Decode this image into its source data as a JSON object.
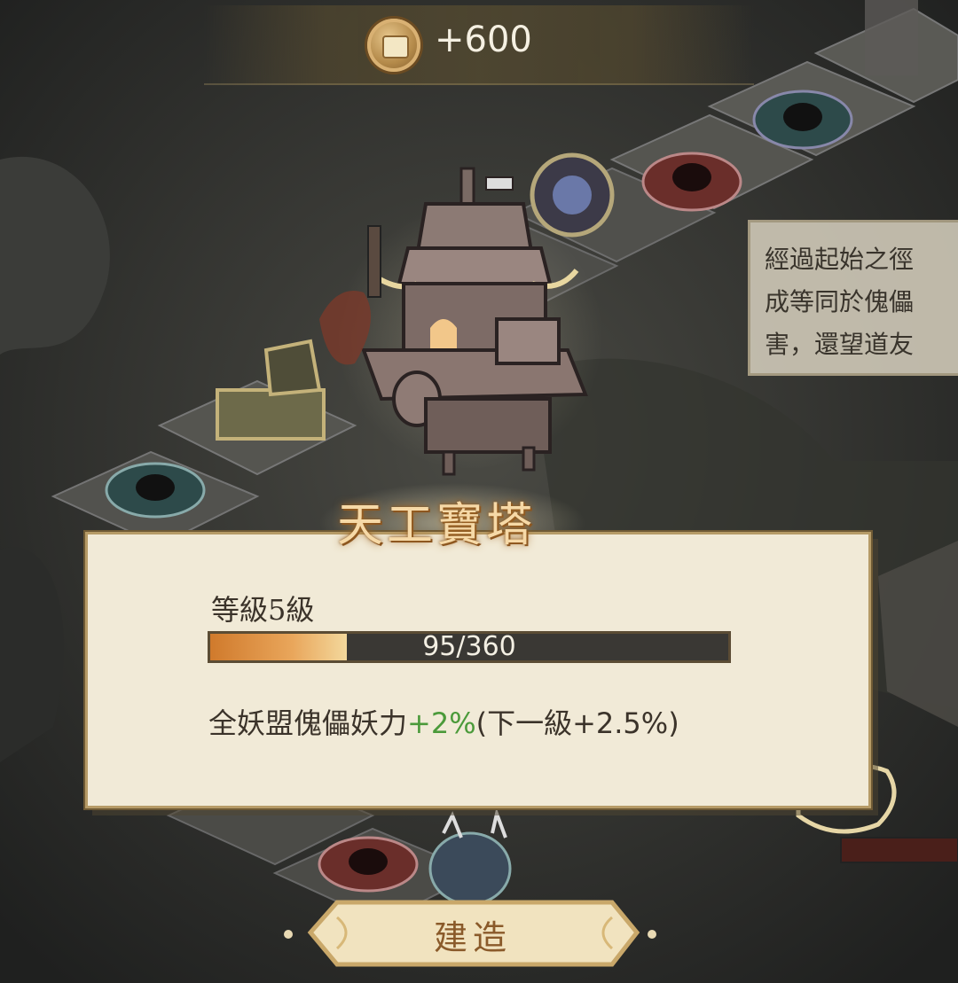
{
  "currency": {
    "icon": "coin-icon",
    "amount": "+600"
  },
  "hint": {
    "lines": [
      "經過起始之徑",
      "成等同於傀儡",
      "害，還望道友"
    ]
  },
  "building": {
    "name": "天工寶塔",
    "level_label": "等級5級",
    "progress": {
      "current": 95,
      "max": 360,
      "fraction": 0.264,
      "text": "95/360"
    },
    "effect_label": "全妖盟傀儡妖力",
    "effect_current": "+2%",
    "effect_next": "(下一級+2.5%)"
  },
  "actions": {
    "build_label": "建造"
  },
  "colors": {
    "accent_green": "#4b9a3a",
    "progress_orange": "#e9a65b",
    "panel_bg": "#f1ead7",
    "title_gold": "#f6d9a7"
  }
}
